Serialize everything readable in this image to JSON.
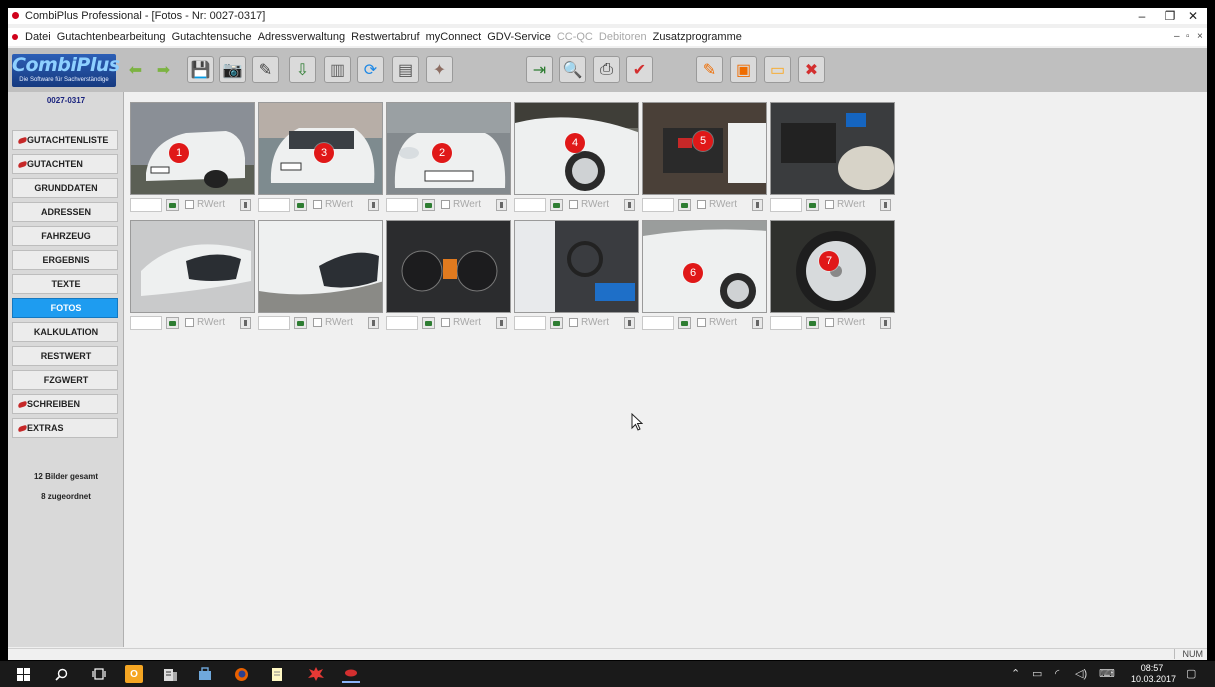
{
  "window": {
    "title": "CombiPlus Professional - [Fotos - Nr: 0027-0317]",
    "minimize_glyph": "–",
    "restore_glyph": "❐",
    "close_glyph": "✕"
  },
  "menu": {
    "items": [
      {
        "label": "Datei",
        "enabled": true
      },
      {
        "label": "Gutachtenbearbeitung",
        "enabled": true
      },
      {
        "label": "Gutachtensuche",
        "enabled": true
      },
      {
        "label": "Adressverwaltung",
        "enabled": true
      },
      {
        "label": "Restwertabruf",
        "enabled": true
      },
      {
        "label": "myConnect",
        "enabled": true
      },
      {
        "label": "GDV-Service",
        "enabled": true
      },
      {
        "label": "CC-QC",
        "enabled": false
      },
      {
        "label": "Debitoren",
        "enabled": false
      },
      {
        "label": "Zusatzprogramme",
        "enabled": true
      }
    ],
    "mdi_min": "–",
    "mdi_restore": "▫",
    "mdi_close": "×"
  },
  "logo": {
    "brand": "CombiPlus",
    "tagline": "Die Software für Sachverständige"
  },
  "toolbar": {
    "buttons": [
      {
        "icon": "arrow-left-icon",
        "glyph": "⬅",
        "color": "#7cb342"
      },
      {
        "icon": "arrow-right-icon",
        "glyph": "➡",
        "color": "#7cb342"
      },
      {
        "icon": "save-icon",
        "glyph": "💾",
        "color": "#333"
      },
      {
        "icon": "camera-icon",
        "glyph": "📷",
        "color": "#555"
      },
      {
        "icon": "edit-photo-icon",
        "glyph": "✎",
        "color": "#444"
      },
      {
        "icon": "import-photo-icon",
        "glyph": "⇩",
        "color": "#2e7d32"
      },
      {
        "icon": "bucket-icon",
        "glyph": "▥",
        "color": "#666"
      },
      {
        "icon": "refresh-icon",
        "glyph": "⟳",
        "color": "#1e88e5"
      },
      {
        "icon": "documents-icon",
        "glyph": "▤",
        "color": "#555"
      },
      {
        "icon": "tools-icon",
        "glyph": "✦",
        "color": "#8d6e63"
      },
      {
        "icon": "export-icon",
        "glyph": "⇥",
        "color": "#2e7d32"
      },
      {
        "icon": "preview-icon",
        "glyph": "🔍",
        "color": "#333"
      },
      {
        "icon": "print-icon",
        "glyph": "⎙",
        "color": "#333"
      },
      {
        "icon": "check-icon",
        "glyph": "✔",
        "color": "#d32f2f"
      },
      {
        "icon": "note-edit-icon",
        "glyph": "✎",
        "color": "#ef6c00"
      },
      {
        "icon": "window-icon",
        "glyph": "▣",
        "color": "#ef6c00"
      },
      {
        "icon": "folder-icon",
        "glyph": "▭",
        "color": "#f9a825"
      },
      {
        "icon": "close-document-icon",
        "glyph": "✖",
        "color": "#d32f2f"
      }
    ]
  },
  "sidebar": {
    "case_number": "0027-0317",
    "items": [
      {
        "label": "GUTACHTENLISTE",
        "marker": true,
        "active": false
      },
      {
        "label": "GUTACHTEN",
        "marker": true,
        "active": false
      },
      {
        "label": "GRUNDDATEN",
        "marker": false,
        "active": false
      },
      {
        "label": "ADRESSEN",
        "marker": false,
        "active": false
      },
      {
        "label": "FAHRZEUG",
        "marker": false,
        "active": false
      },
      {
        "label": "ERGEBNIS",
        "marker": false,
        "active": false
      },
      {
        "label": "TEXTE",
        "marker": false,
        "active": false
      },
      {
        "label": "FOTOS",
        "marker": false,
        "active": true
      },
      {
        "label": "KALKULATION",
        "marker": false,
        "active": false
      },
      {
        "label": "RESTWERT",
        "marker": false,
        "active": false
      },
      {
        "label": "FZGWERT",
        "marker": false,
        "active": false
      },
      {
        "label": "SCHREIBEN",
        "marker": true,
        "active": false
      },
      {
        "label": "EXTRAS",
        "marker": true,
        "active": false
      }
    ],
    "total_images": "12 Bilder gesamt",
    "assigned": "8 zugeordnet"
  },
  "photos": {
    "rwert_label": "RWert",
    "items": [
      {
        "badge": "1",
        "subject": "front-quarter",
        "bg": "#8a8f96"
      },
      {
        "badge": "3",
        "subject": "rear",
        "bg": "#7e8b8f"
      },
      {
        "badge": "2",
        "subject": "front",
        "bg": "#848a8e"
      },
      {
        "badge": "4",
        "subject": "wheel-arch",
        "bg": "#6d6e66"
      },
      {
        "badge": "5",
        "subject": "engine-bay",
        "bg": "#5a5048"
      },
      {
        "badge": "",
        "subject": "engine-detail",
        "bg": "#4a4c4e"
      },
      {
        "badge": "",
        "subject": "headlight",
        "bg": "#8a8a86"
      },
      {
        "badge": "",
        "subject": "headlight-close",
        "bg": "#9c9a93"
      },
      {
        "badge": "",
        "subject": "dashboard",
        "bg": "#2b2c2e"
      },
      {
        "badge": "",
        "subject": "interior",
        "bg": "#5b5e63"
      },
      {
        "badge": "6",
        "subject": "rear-side",
        "bg": "#8a8d8c"
      },
      {
        "badge": "7",
        "subject": "wheel",
        "bg": "#3c3d3a"
      }
    ]
  },
  "statusbar": {
    "num": "NUM"
  },
  "taskbar": {
    "time": "08:57",
    "date": "10.03.2017"
  }
}
